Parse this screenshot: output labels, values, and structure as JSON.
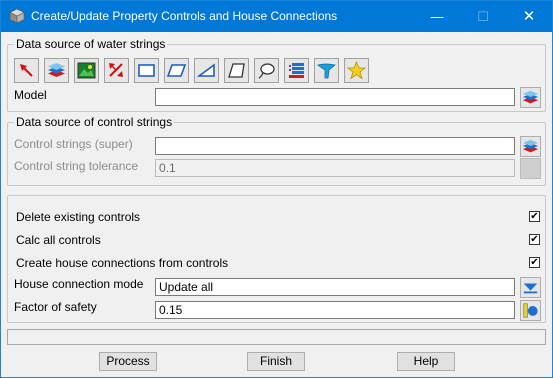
{
  "window": {
    "title": "Create/Update Property Controls and House Connections",
    "minimize": "—",
    "maximize": "☐",
    "close": "✕"
  },
  "water": {
    "group_title": "Data source of water strings",
    "tools": [
      "pick-string",
      "model",
      "view",
      "filter",
      "rectangle",
      "polygon",
      "triangle",
      "lasso-polygon",
      "lasso",
      "tin-layers",
      "function",
      "favourites"
    ],
    "model_label": "Model",
    "model_value": ""
  },
  "control": {
    "group_title": "Data source of control strings",
    "strings_label": "Control strings (super)",
    "strings_value": "",
    "tolerance_label": "Control string tolerance",
    "tolerance_value": "0.1"
  },
  "options": {
    "delete_label": "Delete existing controls",
    "delete_checked": "✔",
    "calc_label": "Calc all controls",
    "calc_checked": "✔",
    "house_label": "Create house connections from controls",
    "house_checked": "✔",
    "mode_label": "House connection mode",
    "mode_value": "Update all",
    "safety_label": "Factor of safety",
    "safety_value": "0.15"
  },
  "status_text": "",
  "buttons": {
    "process": "Process",
    "finish": "Finish",
    "help": "Help"
  },
  "colors": {
    "titlebar": "#0078d7",
    "accent_blue": "#1f6fd1"
  }
}
